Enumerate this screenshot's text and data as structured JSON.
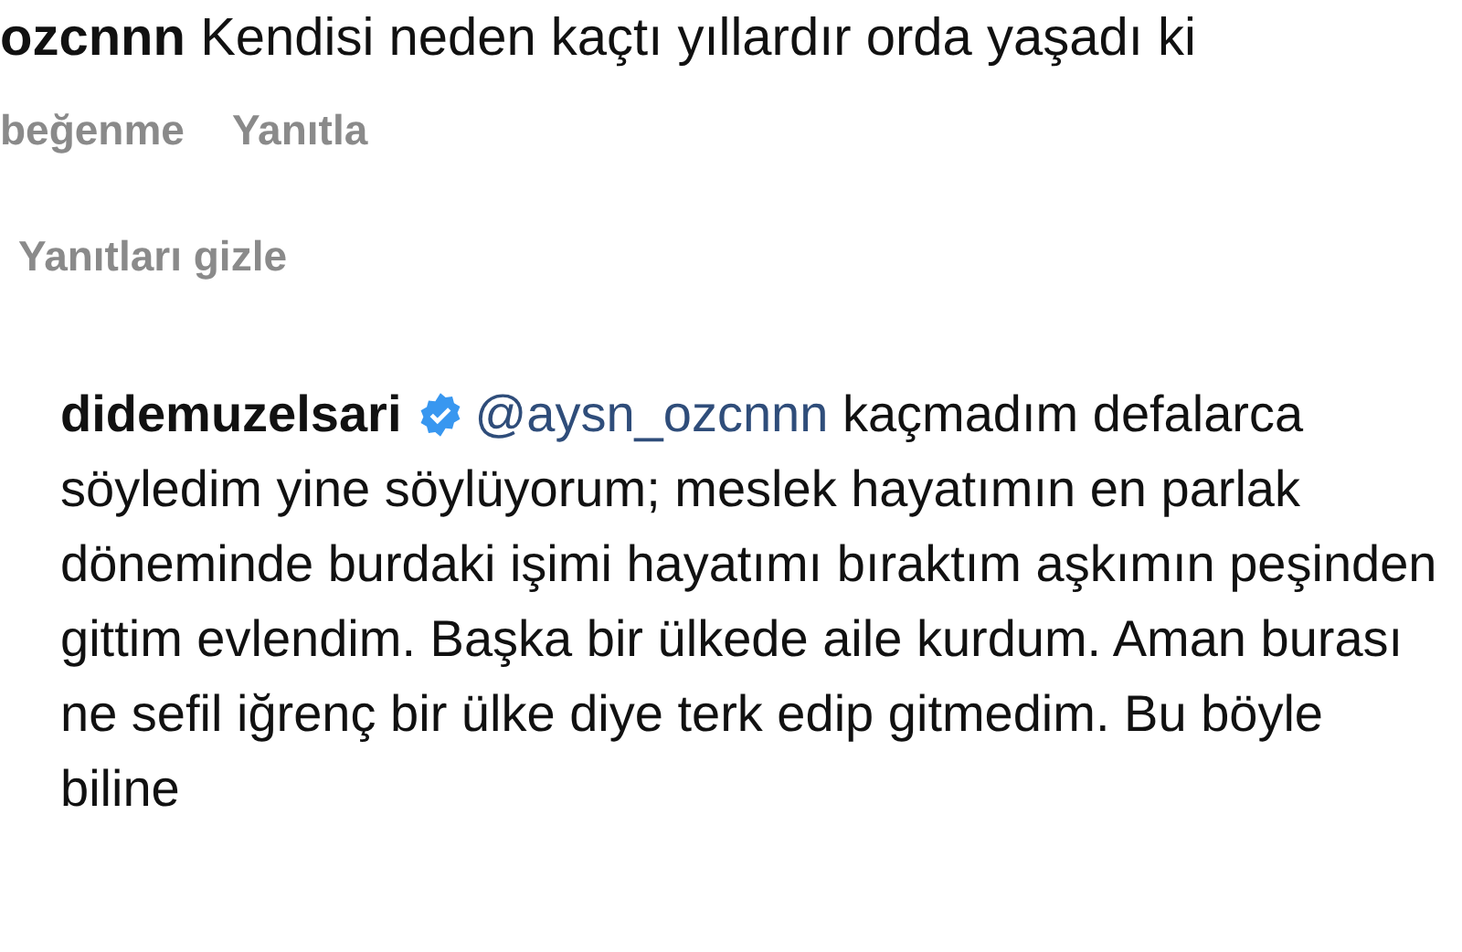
{
  "comment": {
    "username": "ozcnnn",
    "text": "Kendisi neden kaçtı yıllardır orda yaşadı ki",
    "actions": [
      "beğenme",
      "Yanıtla"
    ]
  },
  "hide_replies": "Yanıtları gizle",
  "reply": {
    "username": "didemuzelsari",
    "verified": true,
    "mention": "@aysn_ozcnnn",
    "text": "kaçmadım defalarca söyledim yine söylüyorum; meslek hayatımın en parlak döneminde burdaki işimi hayatımı bıraktım aşkımın peşinden gittim evlendim. Başka bir ülkede aile kurdum. Aman burası ne sefil iğrenç bir ülke diye terk edip gitmedim. Bu böyle biline"
  }
}
